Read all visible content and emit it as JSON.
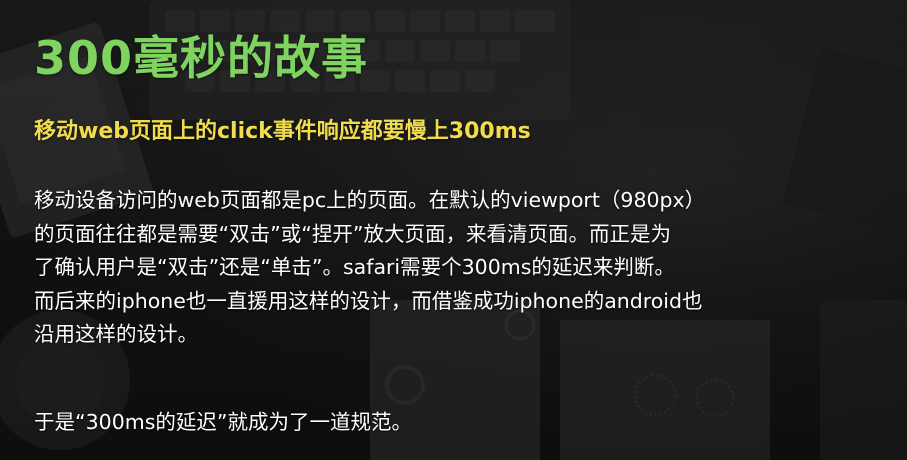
{
  "slide": {
    "title": "300毫秒的故事",
    "subtitle": "移动web页面上的click事件响应都要慢上300ms",
    "paragraph_lines": [
      "移动设备访问的web页面都是pc上的页面。在默认的viewport（980px）",
      "的页面往往都是需要“双击”或“捏开”放大页面，来看清页面。而正是为",
      "了确认用户是“双击”还是“单击”。safari需要个300ms的延迟来判断。",
      "而后来的iphone也一直援用这样的设计，而借鉴成功iphone的android也",
      "沿用这样的设计。"
    ],
    "conclusion": "于是“300ms的延迟”就成为了一道规范。"
  },
  "colors": {
    "title": "#7fd35f",
    "subtitle": "#f1dc4e",
    "body": "#ffffff",
    "background": "#1b1b1b"
  }
}
